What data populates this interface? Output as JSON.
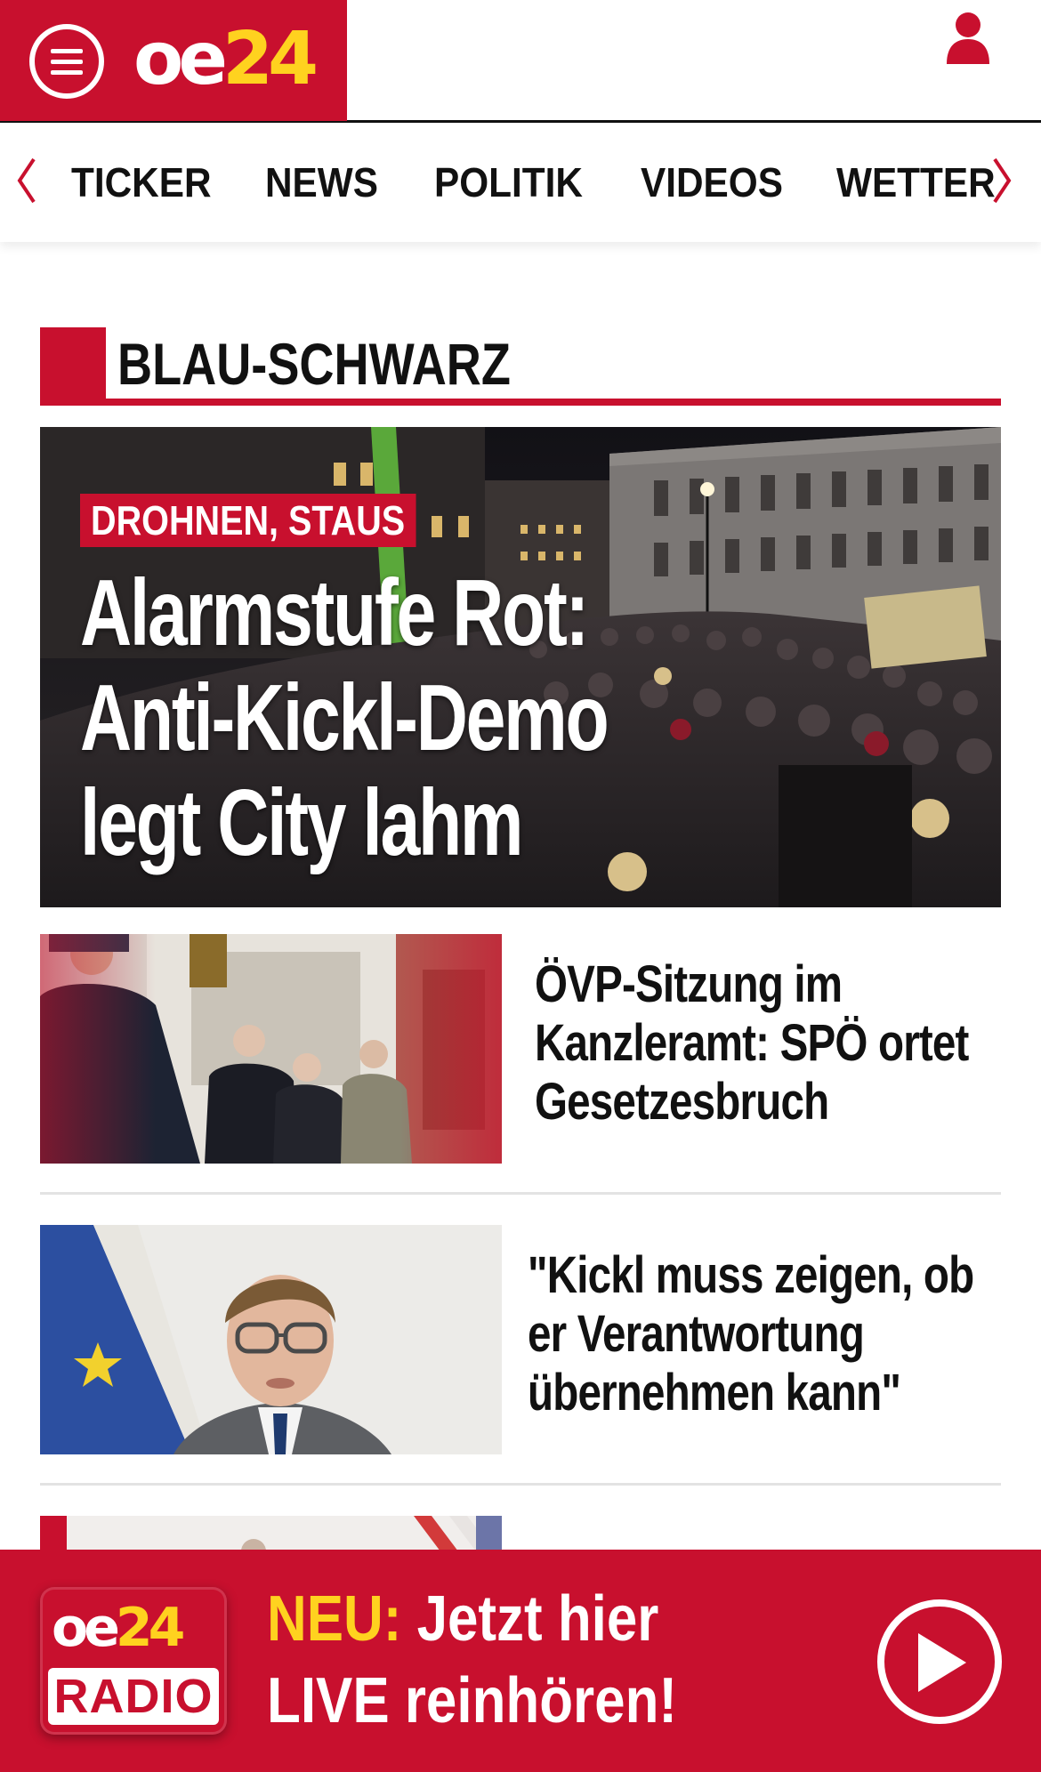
{
  "header": {
    "logo_oe": "oe",
    "logo_24": "24",
    "menu_icon": "hamburger-menu-icon",
    "user_icon": "user-icon"
  },
  "nav": {
    "items": [
      {
        "label": "TICKER"
      },
      {
        "label": "NEWS"
      },
      {
        "label": "POLITIK"
      },
      {
        "label": "VIDEOS"
      },
      {
        "label": "WETTER"
      }
    ],
    "prev_icon": "chevron-left-icon",
    "next_icon": "chevron-right-icon"
  },
  "section": {
    "title": "BLAU-SCHWARZ"
  },
  "hero": {
    "kicker": "DROHNEN, STAUS",
    "title_lines": [
      "Alarmstufe Rot:",
      "Anti-Kickl-Demo",
      "legt City lahm"
    ]
  },
  "articles": [
    {
      "headline_lines": [
        "ÖVP-Sitzung im",
        "Kanzleramt: SPÖ ortet",
        "Gesetzesbruch"
      ]
    },
    {
      "headline_lines": [
        "\"Kickl muss zeigen, ob",
        "er Verantwortung",
        "übernehmen kann\""
      ]
    }
  ],
  "radio": {
    "logo_oe": "oe",
    "logo_24": "24",
    "logo_label": "RADIO",
    "neu": "NEU:",
    "line1_rest": " Jetzt hier",
    "line2": "LIVE reinhören!",
    "play_icon": "play-icon"
  },
  "colors": {
    "brand_red": "#c8102e",
    "brand_yellow": "#ffd21f"
  }
}
